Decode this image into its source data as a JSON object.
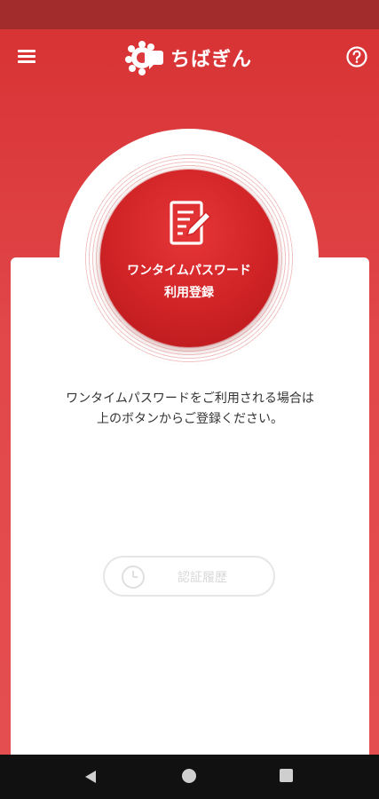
{
  "header": {
    "logo_text": "ちばぎん",
    "menu_icon": "hamburger-menu-icon",
    "help_icon": "question-circle-icon"
  },
  "main_button": {
    "line1": "ワンタイムパスワード",
    "line2": "利用登録",
    "icon": "edit-document-icon"
  },
  "description": {
    "line1": "ワンタイムパスワードをご利用される場合は",
    "line2": "上のボタンからご登録ください。"
  },
  "history_button": {
    "label": "認証履歴",
    "icon": "clock-icon",
    "enabled": false
  },
  "colors": {
    "primary_red": "#dc3a3c",
    "status_bar": "#a22b2c",
    "button_red": "#cf2326"
  }
}
